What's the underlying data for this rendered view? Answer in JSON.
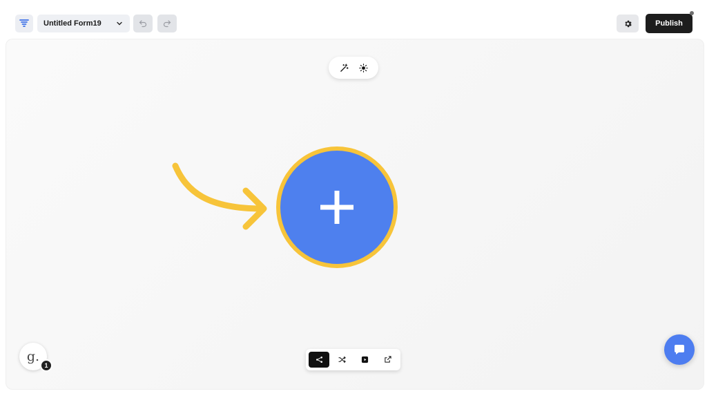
{
  "header": {
    "form_title": "Untitled Form19",
    "publish_label": "Publish",
    "logo_icon": "funnel-logo-icon",
    "undo_icon": "undo-icon",
    "redo_icon": "redo-icon",
    "settings_icon": "gear-icon"
  },
  "theme_toolbar": {
    "items": [
      "magic-wand-icon",
      "sun-icon"
    ]
  },
  "canvas": {
    "add_button_icon": "plus-icon",
    "highlight_color": "#f7c43a",
    "add_button_color": "#4e80ee"
  },
  "bottom_toolbar": {
    "items": [
      "flow-icon",
      "shuffle-icon",
      "play-icon",
      "share-icon"
    ],
    "active_index": 0
  },
  "user": {
    "avatar_letter": "g.",
    "notification_count": "1"
  },
  "chat": {
    "icon": "chat-bubble-icon",
    "color": "#4d7df0"
  }
}
